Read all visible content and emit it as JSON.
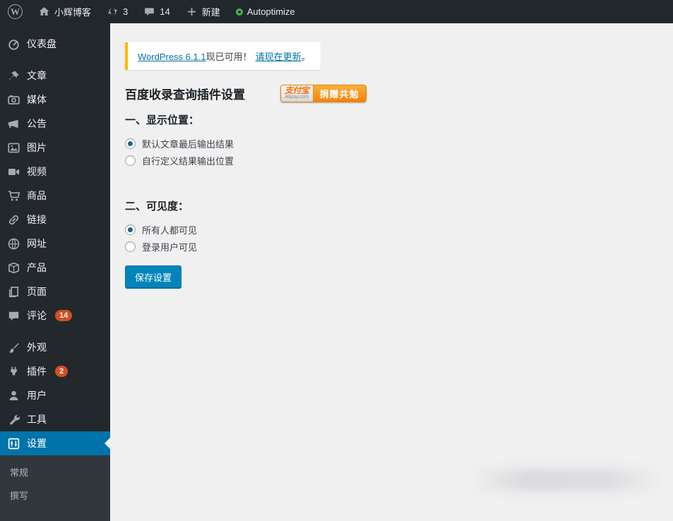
{
  "admin_bar": {
    "site_name": "小辉博客",
    "updates_count": "3",
    "comments_count": "14",
    "new_label": "新建",
    "autoptimize_label": "Autoptimize"
  },
  "sidebar": {
    "items": [
      {
        "label": "仪表盘"
      },
      {
        "label": "文章"
      },
      {
        "label": "媒体"
      },
      {
        "label": "公告"
      },
      {
        "label": "图片"
      },
      {
        "label": "视频"
      },
      {
        "label": "商品"
      },
      {
        "label": "链接"
      },
      {
        "label": "网址"
      },
      {
        "label": "产品"
      },
      {
        "label": "页面"
      },
      {
        "label": "评论",
        "badge": "14"
      },
      {
        "label": "外观"
      },
      {
        "label": "插件",
        "badge": "2"
      },
      {
        "label": "用户"
      },
      {
        "label": "工具"
      },
      {
        "label": "设置",
        "active": true
      }
    ],
    "submenu": [
      {
        "label": "常规"
      },
      {
        "label": "撰写"
      }
    ]
  },
  "main": {
    "update_notice": {
      "update_link": "WordPress 6.1.1",
      "available_text": "现已可用！",
      "action_link": "请现在更新",
      "period": "。"
    },
    "page_title": "百度收录查询插件设置",
    "donate": {
      "alipay_label": "支付宝",
      "alipay_domain": "Alipay.com",
      "donate_label": "捐赠共勉"
    },
    "section_display": {
      "heading": "一、显示位置：",
      "options": [
        {
          "label": "默认文章最后输出结果",
          "selected": true
        },
        {
          "label": "自行定义结果输出位置",
          "selected": false
        }
      ]
    },
    "section_visibility": {
      "heading": "二、可见度：",
      "options": [
        {
          "label": "所有人都可见",
          "selected": true
        },
        {
          "label": "登录用户可见",
          "selected": false
        }
      ]
    },
    "save_button_label": "保存设置"
  },
  "colors": {
    "admin_bar_bg": "#22272c",
    "sidebar_bg": "#23282d",
    "submenu_bg": "#32373c",
    "active_menu_bg": "#0073aa",
    "content_bg": "#f0f0f1",
    "notice_border": "#ffb900",
    "link": "#0073aa",
    "badge_bg": "#d54e21",
    "save_button_bg": "#0085ba",
    "autoptimize_green": "#46b450",
    "donate_orange": "#f28411"
  }
}
